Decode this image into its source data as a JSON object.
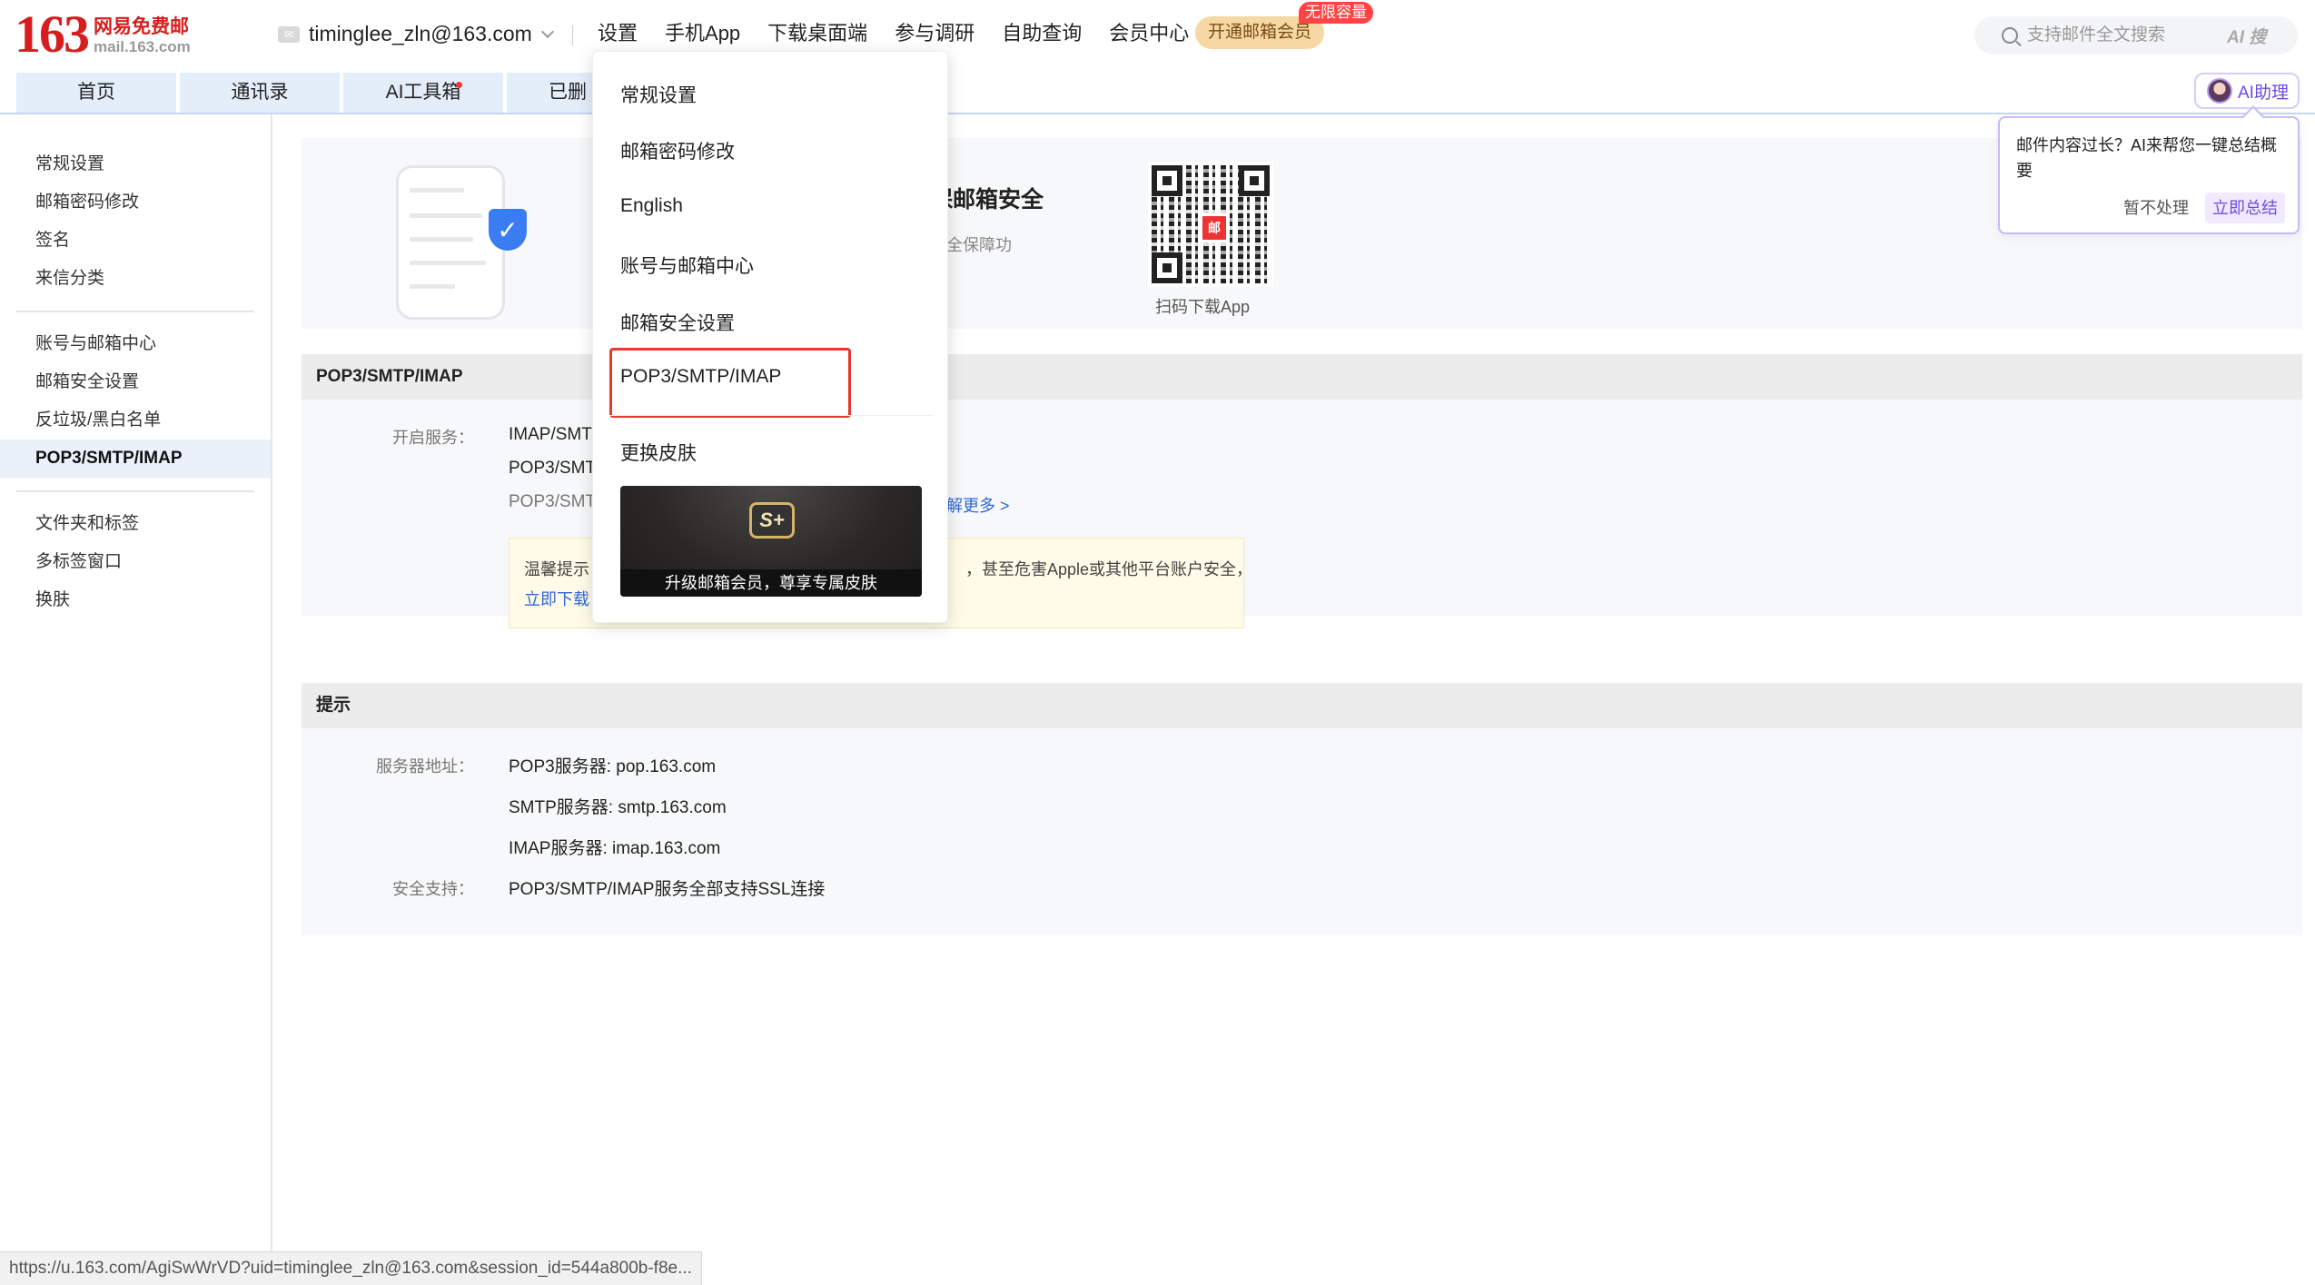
{
  "logo": {
    "number": "163",
    "cn": "网易免费邮",
    "en": "mail.163.com"
  },
  "account": {
    "email": "timinglee_zln@163.com"
  },
  "topnav": [
    "设置",
    "手机App",
    "下载桌面端",
    "参与调研",
    "自助查询",
    "会员中心"
  ],
  "vip": {
    "label": "开通邮箱会员",
    "badge": "无限容量"
  },
  "search": {
    "placeholder": "支持邮件全文搜索",
    "ai_label": "AI 搜"
  },
  "tabs": [
    "首页",
    "通讯录",
    "AI工具箱",
    "已删"
  ],
  "ai_assistant": {
    "label": "AI助理"
  },
  "ai_popup": {
    "text": "邮件内容过长？AI来帮您一键总结概要",
    "skip": "暂不处理",
    "go": "立即总结"
  },
  "sidebar": {
    "group1": [
      "常规设置",
      "邮箱密码修改",
      "签名",
      "来信分类"
    ],
    "group2": [
      "账号与邮箱中心",
      "邮箱安全设置",
      "反垃圾/黑白名单",
      "POP3/SMTP/IMAP"
    ],
    "group3": [
      "文件夹和标签",
      "多标签窗口",
      "换肤"
    ]
  },
  "banner": {
    "title": "保邮箱安全",
    "sub1": "安全保障功",
    "sub2": "。",
    "qr_label": "扫码下载App"
  },
  "pop_section": {
    "title": "POP3/SMTP/IMAP",
    "service_label": "开启服务：",
    "services": [
      "IMAP/SMT",
      "POP3/SMT",
      "POP3/SMT"
    ],
    "learn_more": "解更多 >",
    "tip_prefix": "温馨提示：",
    "tip_link": "立即下载",
    "tip_tail": "，甚至危害Apple或其他平台账户安全，"
  },
  "hint_section": {
    "title": "提示",
    "server_label": "服务器地址：",
    "servers": [
      "POP3服务器: pop.163.com",
      "SMTP服务器: smtp.163.com",
      "IMAP服务器: imap.163.com"
    ],
    "security_label": "安全支持：",
    "security": "POP3/SMTP/IMAP服务全部支持SSL连接"
  },
  "dropdown": {
    "items": [
      "常规设置",
      "邮箱密码修改",
      "English",
      "账号与邮箱中心",
      "邮箱安全设置",
      "POP3/SMTP/IMAP",
      "更换皮肤"
    ],
    "skin_logo": "S+",
    "skin_text": "升级邮箱会员，尊享专属皮肤"
  },
  "statusbar": {
    "url": "https://u.163.com/AgiSwWrVD?uid=timinglee_zln@163.com&session_id=544a800b-f8e..."
  },
  "colors": {
    "brand_red": "#d71d1d",
    "accent_blue": "#2f68d8",
    "highlight_red": "#e6392f",
    "ai_purple": "#6d4ce0"
  }
}
